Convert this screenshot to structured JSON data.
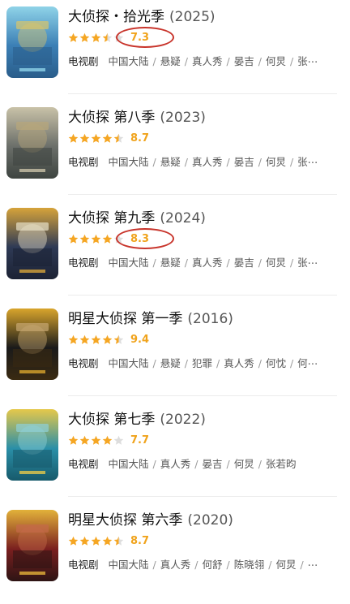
{
  "colors": {
    "star": "#f5a623",
    "star_empty": "#dddddd",
    "score": "#f0a31c",
    "highlight_circle": "#c8342b"
  },
  "items": [
    {
      "title": "大侦探・拾光季",
      "year": "(2025)",
      "stars": 3.5,
      "score": "7.3",
      "circled": true,
      "category": "电视剧",
      "tags": [
        "中国大陆",
        "悬疑",
        "真人秀",
        "晏吉",
        "何炅",
        "张⋯"
      ]
    },
    {
      "title": "大侦探  第八季",
      "year": "(2023)",
      "stars": 4.5,
      "score": "8.7",
      "circled": false,
      "category": "电视剧",
      "tags": [
        "中国大陆",
        "悬疑",
        "真人秀",
        "晏吉",
        "何炅",
        "张⋯"
      ]
    },
    {
      "title": "大侦探  第九季",
      "year": "(2024)",
      "stars": 4,
      "score": "8.3",
      "circled": true,
      "category": "电视剧",
      "tags": [
        "中国大陆",
        "悬疑",
        "真人秀",
        "晏吉",
        "何炅",
        "张⋯"
      ]
    },
    {
      "title": "明星大侦探  第一季",
      "year": "(2016)",
      "stars": 4.5,
      "score": "9.4",
      "circled": false,
      "category": "电视剧",
      "tags": [
        "中国大陆",
        "悬疑",
        "犯罪",
        "真人秀",
        "何忱",
        "何⋯"
      ]
    },
    {
      "title": "大侦探  第七季",
      "year": "(2022)",
      "stars": 4,
      "score": "7.7",
      "circled": false,
      "category": "电视剧",
      "tags": [
        "中国大陆",
        "真人秀",
        "晏吉",
        "何炅",
        "张若昀"
      ]
    },
    {
      "title": "明星大侦探  第六季",
      "year": "(2020)",
      "stars": 4.5,
      "score": "8.7",
      "circled": false,
      "category": "电视剧",
      "tags": [
        "中国大陆",
        "真人秀",
        "何舒",
        "陈晓翎",
        "何炅",
        "⋯"
      ]
    }
  ]
}
